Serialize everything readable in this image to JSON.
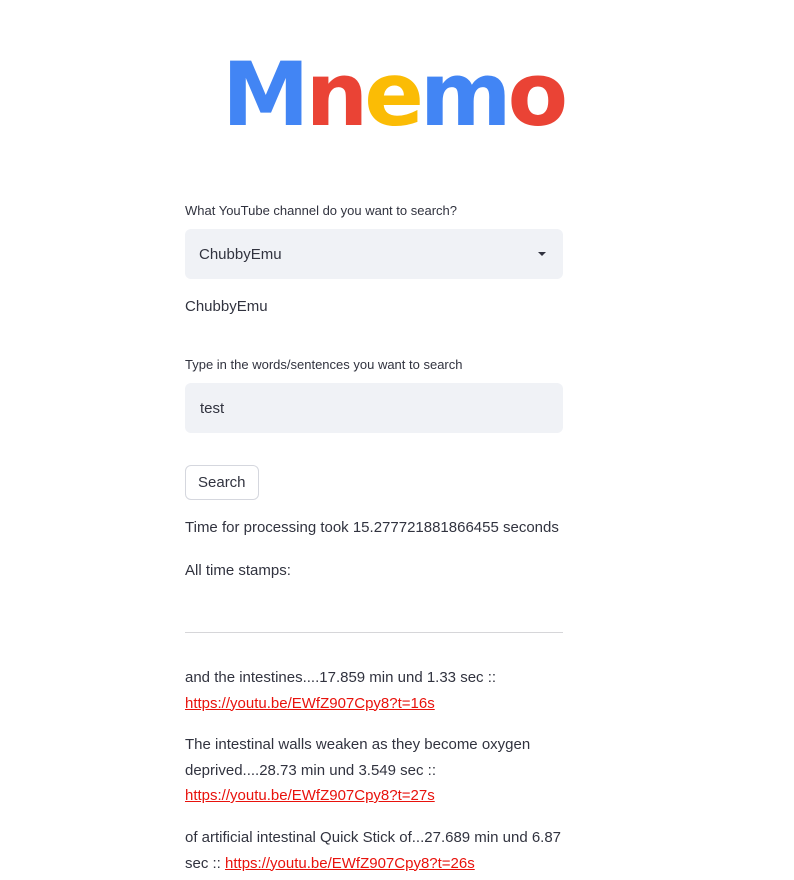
{
  "logo": {
    "letters": [
      {
        "char": "M",
        "color": "#4285f4"
      },
      {
        "char": "n",
        "color": "#ea4335"
      },
      {
        "char": "e",
        "color": "#fbbc05"
      },
      {
        "char": "m",
        "color": "#4285f4"
      },
      {
        "char": "o",
        "color": "#ea4335"
      }
    ]
  },
  "channel_select": {
    "label": "What YouTube channel do you want to search?",
    "selected_value": "ChubbyEmu",
    "icon": "chevron-down-icon"
  },
  "selected_channel_echo": "ChubbyEmu",
  "search_input": {
    "label": "Type in the words/sentences you want to search",
    "value": "test"
  },
  "search_button": {
    "label": "Search"
  },
  "processing_time_text": "Time for processing took 15.277721881866455 seconds",
  "timestamps_heading": "All time stamps:",
  "results": [
    {
      "text": "and the intestines....17.859 min und 1.33 sec :: ",
      "link": "https://youtu.be/EWfZ907Cpy8?t=16s"
    },
    {
      "text": "The intestinal walls weaken as they become oxygen deprived....28.73 min und 3.549 sec :: ",
      "link": "https://youtu.be/EWfZ907Cpy8?t=27s"
    },
    {
      "text": "of artificial intestinal Quick Stick of...27.689 min und 6.87 sec :: ",
      "link": "https://youtu.be/EWfZ907Cpy8?t=26s"
    }
  ],
  "colors": {
    "link": "#e8120c",
    "input_bg": "#f0f2f6",
    "text": "#31333f"
  }
}
